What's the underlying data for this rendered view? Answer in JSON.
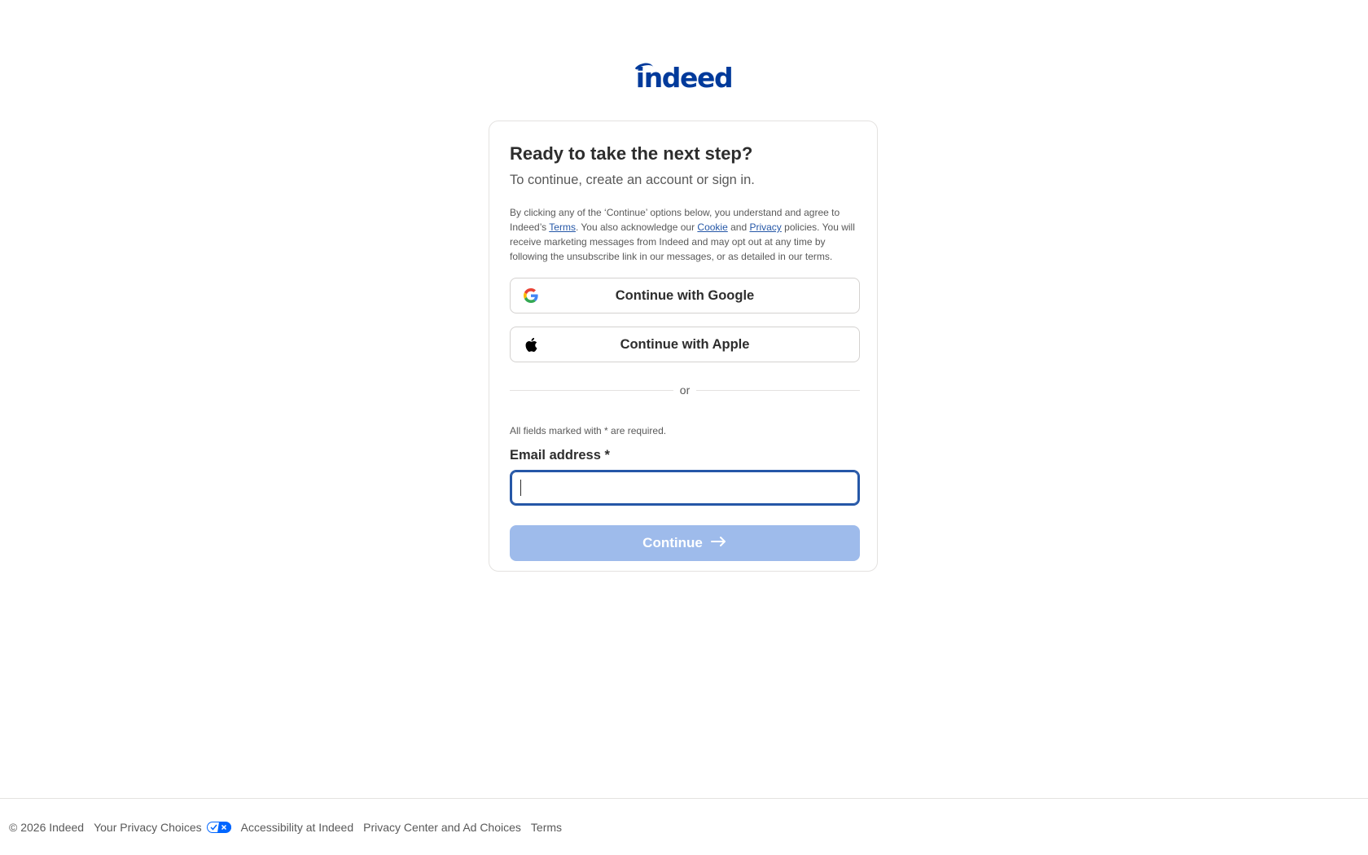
{
  "logo": {
    "text": "indeed",
    "color": "#003a9b"
  },
  "card": {
    "title": "Ready to take the next step?",
    "subtitle": "To continue, create an account or sign in.",
    "legal": {
      "part1": "By clicking any of the ‘Continue’ options below, you understand and agree to Indeed’s ",
      "terms_link": "Terms",
      "part2": ". You also acknowledge our ",
      "cookie_link": "Cookie",
      "part3": " and ",
      "privacy_link": "Privacy",
      "part4": " policies. You will receive marketing messages from Indeed and may opt out at any time by following the unsubscribe link in our messages, or as detailed in our terms."
    },
    "google_button": {
      "label": "Continue with Google",
      "icon": "google-icon"
    },
    "apple_button": {
      "label": "Continue with Apple",
      "icon": "apple-icon"
    },
    "divider_text": "or",
    "required_note": "All fields marked with * are required.",
    "email": {
      "label": "Email address *",
      "value": "",
      "placeholder": ""
    },
    "continue_button": {
      "label": "Continue",
      "icon": "arrow-right-icon",
      "color": "#9ebbeb"
    }
  },
  "footer": {
    "copyright": "© 2026 Indeed",
    "privacy_choices": "Your Privacy Choices",
    "accessibility": "Accessibility at Indeed",
    "privacy_center": "Privacy Center and Ad Choices",
    "terms": "Terms"
  },
  "colors": {
    "brand_blue": "#003a9b",
    "link_blue": "#2557a7",
    "border": "#e4e2e0"
  }
}
